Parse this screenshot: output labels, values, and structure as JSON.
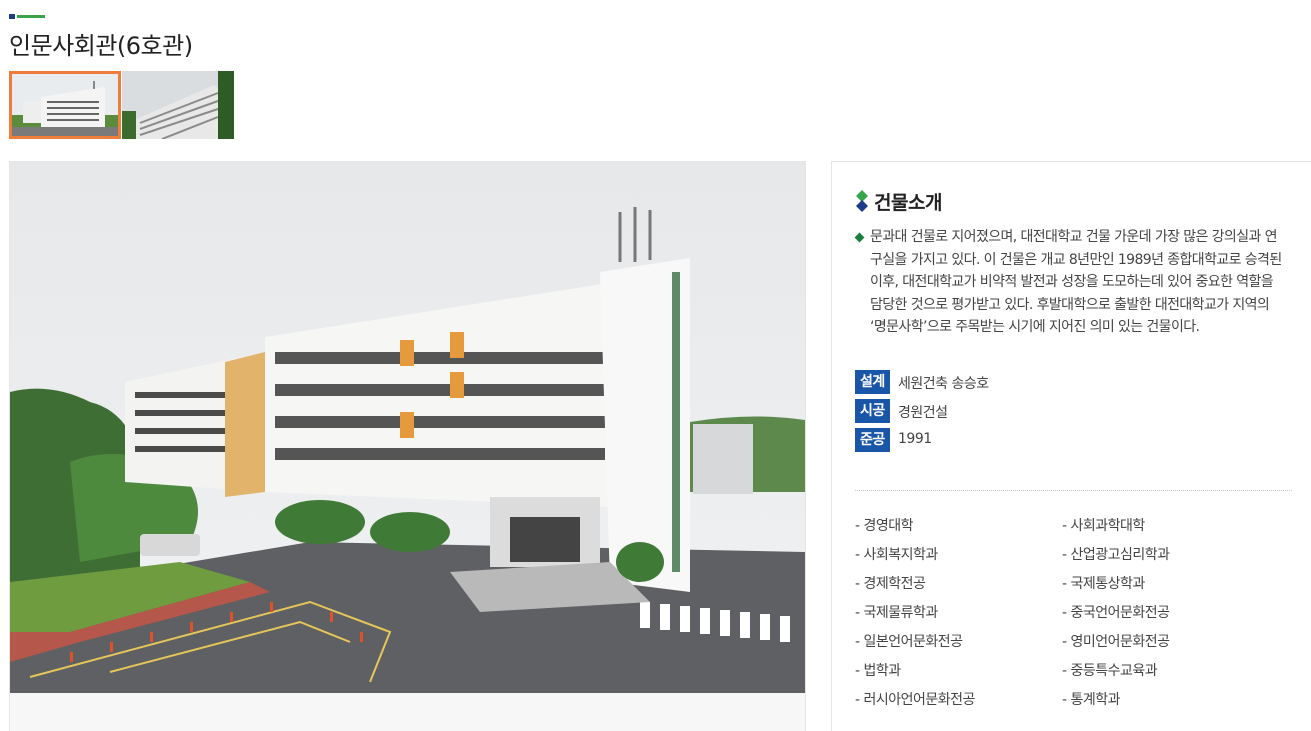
{
  "page": {
    "title": "인문사회관(6호관)"
  },
  "thumbnails": [
    {
      "name": "building-front-thumbnail",
      "selected": true
    },
    {
      "name": "building-side-thumbnail",
      "selected": false
    }
  ],
  "info": {
    "section_title": "건물소개",
    "description": "문과대 건물로 지어졌으며, 대전대학교 건물 가운데 가장 많은 강의실과 연구실을 가지고 있다. 이 건물은 개교 8년만인 1989년 종합대학교로 승격된 이후, 대전대학교가 비약적 발전과 성장을 도모하는데 있어 중요한 역할을 담당한 것으로 평가받고 있다. 후발대학으로 출발한 대전대학교가 지역의 ‘명문사학’으로 주목받는 시기에 지어진 의미 있는 건물이다.",
    "facts": [
      {
        "label": "설계",
        "value": "세원건축 송승호"
      },
      {
        "label": "시공",
        "value": "경원건설"
      },
      {
        "label": "준공",
        "value": "1991"
      }
    ],
    "departments": [
      "- 경영대학",
      "- 사회과학대학",
      "- 사회복지학과",
      "- 산업광고심리학과",
      "- 경제학전공",
      "- 국제통상학과",
      "- 국제물류학과",
      "- 중국언어문화전공",
      "- 일본언어문화전공",
      "- 영미언어문화전공",
      "- 법학과",
      "- 중등특수교육과",
      "- 러시아언어문화전공",
      "- 통계학과"
    ]
  },
  "colors": {
    "accent_blue": "#1a56a8",
    "accent_green": "#3aa548",
    "thumb_selected_border": "#f07c3c"
  },
  "icons": {
    "section_icon": "diamond-icon",
    "bullet_icon": "diamond-bullet-icon"
  }
}
